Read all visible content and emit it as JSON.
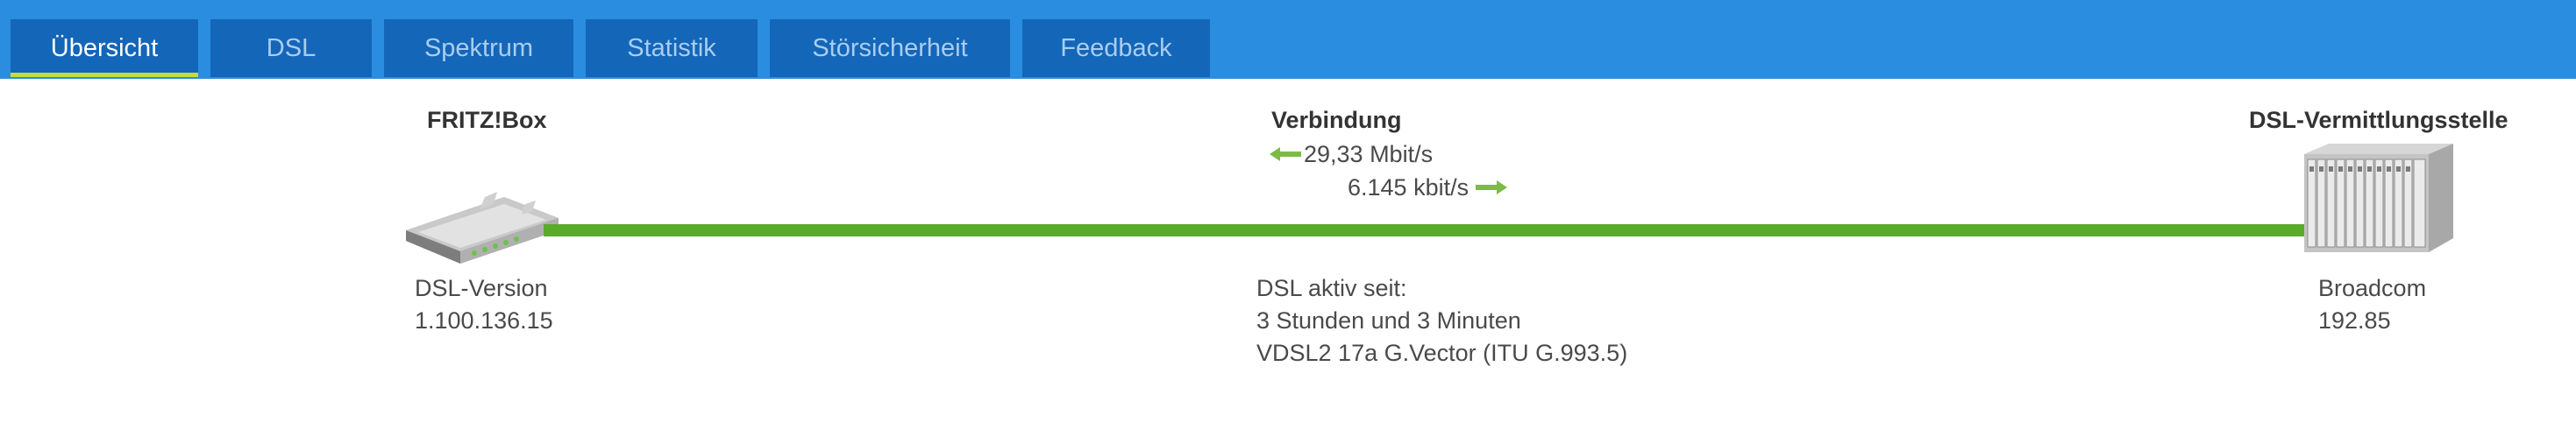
{
  "tabs": [
    {
      "label": "Übersicht",
      "active": true
    },
    {
      "label": "DSL",
      "active": false
    },
    {
      "label": "Spektrum",
      "active": false
    },
    {
      "label": "Statistik",
      "active": false
    },
    {
      "label": "Störsicherheit",
      "active": false
    },
    {
      "label": "Feedback",
      "active": false
    }
  ],
  "colors": {
    "header": "#2b8ddf",
    "tab_bg": "#1466b8",
    "tab_active_underline": "#c6dc3c",
    "line": "#5aab2b"
  },
  "fritzbox": {
    "title": "FRITZ!Box",
    "version_label": "DSL-Version",
    "version_value": "1.100.136.15",
    "icon": "router-icon"
  },
  "connection": {
    "title": "Verbindung",
    "downstream": "29,33 Mbit/s",
    "upstream": "6.145 kbit/s",
    "active_since_label": "DSL aktiv seit:",
    "active_since_value": "3 Stunden und 3 Minuten",
    "mode": "VDSL2 17a G.Vector (ITU G.993.5)"
  },
  "exchange": {
    "title": "DSL-Vermittlungsstelle",
    "vendor": "Broadcom",
    "version": "192.85",
    "icon": "dslam-icon"
  }
}
